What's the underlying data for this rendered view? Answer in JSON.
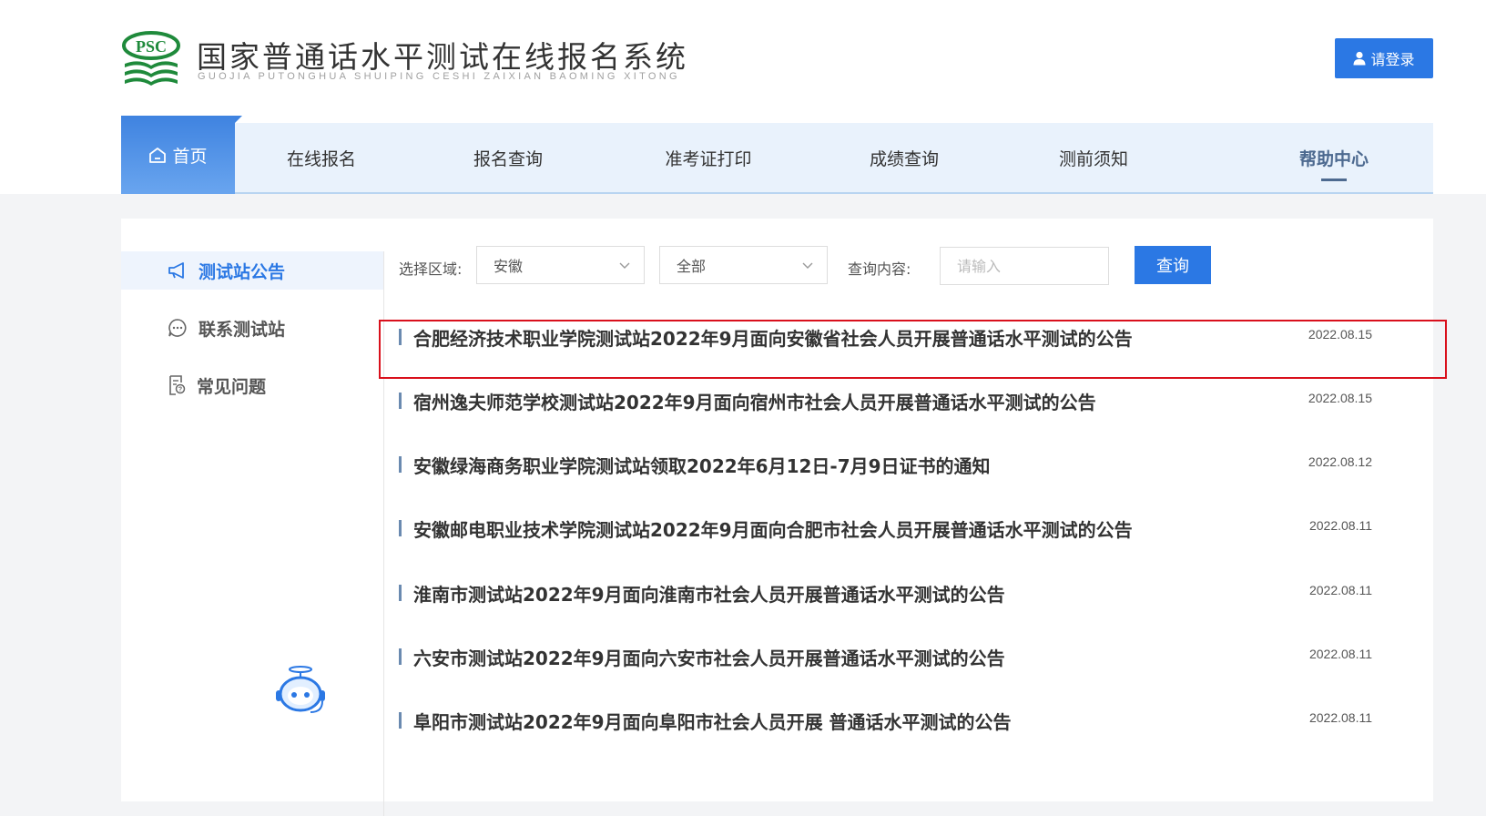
{
  "header": {
    "title": "国家普通话水平测试在线报名系统",
    "subtitle": "GUOJIA PUTONGHUA SHUIPING CESHI ZAIXIAN BAOMING XITONG",
    "logo_text": "PSC",
    "login_label": "请登录"
  },
  "nav": {
    "items": [
      {
        "label": "首页"
      },
      {
        "label": "在线报名"
      },
      {
        "label": "报名查询"
      },
      {
        "label": "准考证打印"
      },
      {
        "label": "成绩查询"
      },
      {
        "label": "测前须知"
      },
      {
        "label": "帮助中心"
      }
    ]
  },
  "sidebar": {
    "items": [
      {
        "label": "测试站公告",
        "icon": "megaphone-icon",
        "active": true
      },
      {
        "label": "联系测试站",
        "icon": "chat-bubble-icon"
      },
      {
        "label": "常见问题",
        "icon": "faq-document-icon"
      }
    ]
  },
  "filters": {
    "region_label": "选择区域:",
    "region_value": "安徽",
    "scope_value": "全部",
    "query_label": "查询内容:",
    "query_placeholder": "请输入",
    "query_button": "查询"
  },
  "announcements": [
    {
      "title": "合肥经济技术职业学院测试站2022年9月面向安徽省社会人员开展普通话水平测试的公告",
      "date": "2022.08.15",
      "highlighted": true
    },
    {
      "title": "宿州逸夫师范学校测试站2022年9月面向宿州市社会人员开展普通话水平测试的公告",
      "date": "2022.08.15"
    },
    {
      "title": "安徽绿海商务职业学院测试站领取2022年6月12日-7月9日证书的通知",
      "date": "2022.08.12"
    },
    {
      "title": "安徽邮电职业技术学院测试站2022年9月面向合肥市社会人员开展普通话水平测试的公告",
      "date": "2022.08.11"
    },
    {
      "title": "淮南市测试站2022年9月面向淮南市社会人员开展普通话水平测试的公告",
      "date": "2022.08.11"
    },
    {
      "title": "六安市测试站2022年9月面向六安市社会人员开展普通话水平测试的公告",
      "date": "2022.08.11"
    },
    {
      "title": "阜阳市测试站2022年9月面向阜阳市社会人员开展 普通话水平测试的公告",
      "date": "2022.08.11"
    }
  ],
  "colors": {
    "primary": "#2b78e4",
    "nav_bg": "#e9f2fc",
    "highlight_border": "#d9101c",
    "logo_green": "#1f8a3b"
  }
}
